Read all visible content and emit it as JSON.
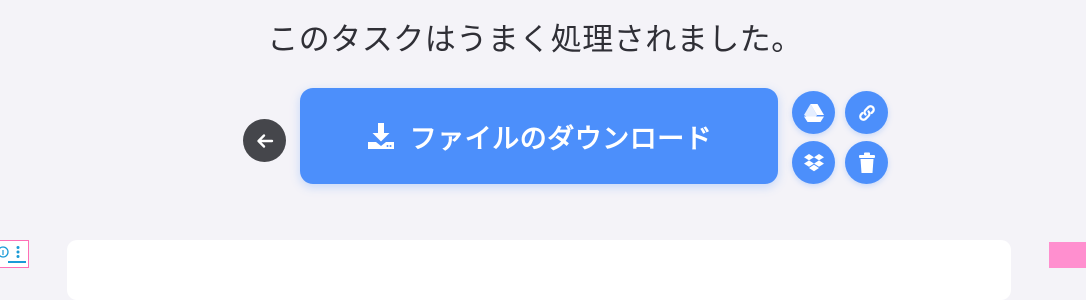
{
  "status": {
    "title": "このタスクはうまく処理されました。"
  },
  "actions": {
    "download_label": "ファイルのダウンロード",
    "icons": {
      "back": "arrow-left-icon",
      "download": "download-icon",
      "drive": "google-drive-icon",
      "link": "link-icon",
      "dropbox": "dropbox-icon",
      "delete": "trash-icon"
    }
  },
  "colors": {
    "accent": "#4c8ffb",
    "back_button": "#45464b",
    "background": "#f4f3f8",
    "pink": "#ff8fcf"
  }
}
